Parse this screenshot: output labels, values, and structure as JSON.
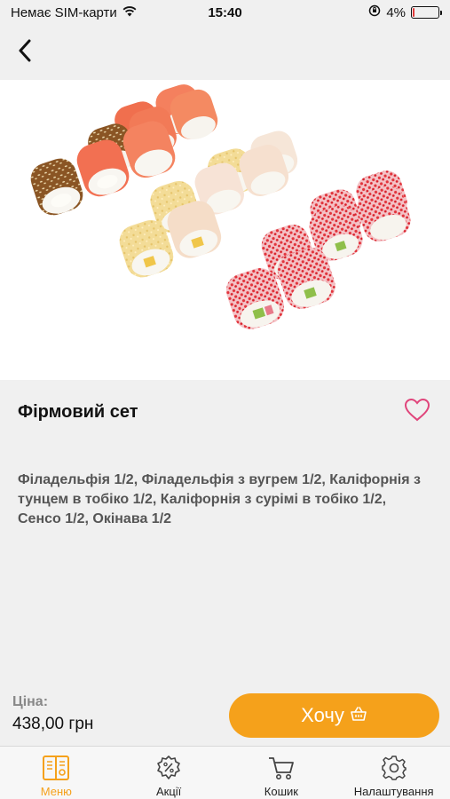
{
  "status_bar": {
    "carrier": "Немає SIM-карти",
    "time": "15:40",
    "battery_percent": "4%",
    "battery_level": 0.04
  },
  "product": {
    "title": "Фірмовий сет",
    "description": "Філадельфія 1/2, Філадельфія з вугрем 1/2, Каліфорнія з тунцем в тобіко 1/2, Каліфорнія з сурімі в тобіко 1/2, Сенсо 1/2, Окінава 1/2",
    "favorite_icon": "heart-outline-icon"
  },
  "price": {
    "label": "Ціна:",
    "value": "438,00 грн"
  },
  "want_button": {
    "label": "Хочу",
    "icon": "basket-icon"
  },
  "tabs": [
    {
      "label": "Меню",
      "icon": "menu-book-icon",
      "active": true
    },
    {
      "label": "Акції",
      "icon": "discount-gear-icon",
      "active": false
    },
    {
      "label": "Кошик",
      "icon": "cart-icon",
      "active": false
    },
    {
      "label": "Налаштування",
      "icon": "settings-gear-icon",
      "active": false
    }
  ],
  "colors": {
    "accent": "#f5a11b",
    "background": "#f0f0f0",
    "heart": "#e0457b"
  }
}
